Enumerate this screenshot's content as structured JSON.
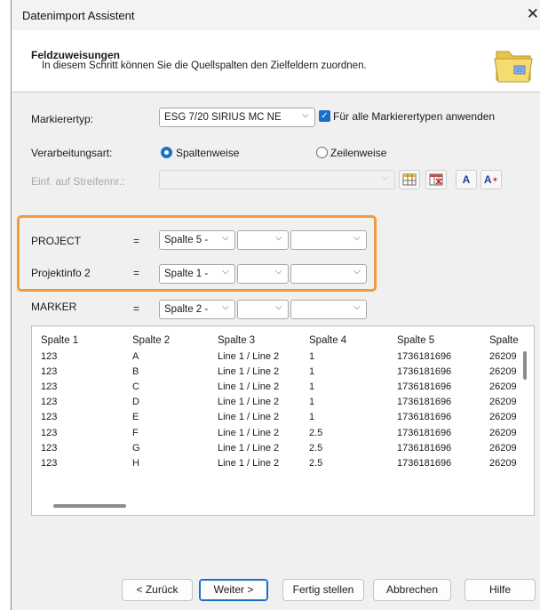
{
  "window": {
    "title": "Datenimport Assistent",
    "close_glyph": "✕"
  },
  "header": {
    "title": "Feldzuweisungen",
    "description": "In diesem Schritt können Sie die Quellspalten den Zielfeldern zuordnen.",
    "icon": "folder-icon"
  },
  "form": {
    "marker_type_label": "Markierertyp:",
    "marker_type_value": "ESG 7/20 SIRIUS MC NE",
    "apply_all_label": "Für alle Markierertypen anwenden",
    "apply_all_checked": true,
    "processing_label": "Verarbeitungsart:",
    "radio_columns_label": "Spaltenweise",
    "radio_rows_label": "Zeilenweise",
    "processing_selected": "Spaltenweise",
    "insert_label": "Einf. auf Streifennr.:",
    "tool_a_label": "A",
    "tool_a2_label": "A"
  },
  "mappings": [
    {
      "field": "PROJECT",
      "eq": "=",
      "col1": "Spalte 5 -",
      "col2": "",
      "col3": ""
    },
    {
      "field": "Projektinfo 2",
      "eq": "=",
      "col1": "Spalte 1 -",
      "col2": "",
      "col3": ""
    },
    {
      "field": "MARKER",
      "eq": "=",
      "col1": "Spalte 2 -",
      "col2": "",
      "col3": ""
    }
  ],
  "grid": {
    "headers": [
      "Spalte 1",
      "Spalte 2",
      "Spalte 3",
      "Spalte 4",
      "Spalte 5",
      "Spalte"
    ],
    "rows": [
      [
        "123",
        "A",
        "Line 1 / Line 2",
        "1",
        "1736181696",
        "26209"
      ],
      [
        "123",
        "B",
        "Line 1 / Line 2",
        "1",
        "1736181696",
        "26209"
      ],
      [
        "123",
        "C",
        "Line 1 / Line 2",
        "1",
        "1736181696",
        "26209"
      ],
      [
        "123",
        "D",
        "Line 1 / Line 2",
        "1",
        "1736181696",
        "26209"
      ],
      [
        "123",
        "E",
        "Line 1 / Line 2",
        "1",
        "1736181696",
        "26209"
      ],
      [
        "123",
        "F",
        "Line 1 / Line 2",
        "2.5",
        "1736181696",
        "26209"
      ],
      [
        "123",
        "G",
        "Line 1 / Line 2",
        "2.5",
        "1736181696",
        "26209"
      ],
      [
        "123",
        "H",
        "Line 1 / Line 2",
        "2.5",
        "1736181696",
        "26209"
      ]
    ]
  },
  "footer": {
    "back": "< Zurück",
    "next": "Weiter >",
    "finish": "Fertig stellen",
    "cancel": "Abbrechen",
    "help": "Hilfe"
  },
  "colors": {
    "accent": "#1a6fc9",
    "highlight": "#f39a3a"
  }
}
